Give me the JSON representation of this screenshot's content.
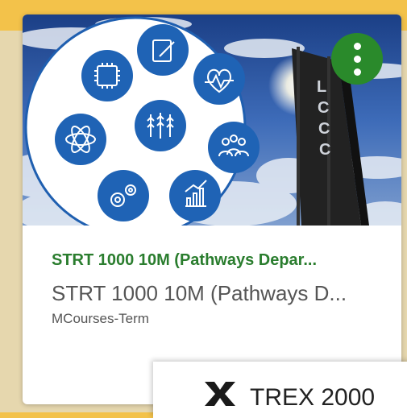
{
  "course_card": {
    "title": "STRT 1000 10M (Pathways Depar...",
    "subtitle": "STRT 1000 10M (Pathways D...",
    "term": "MCourses-Term",
    "banner_tower_text": "LCCC",
    "accent_color": "#2a8a2b",
    "icons": [
      "chip-icon",
      "edit-icon",
      "heart-monitor-icon",
      "atom-icon",
      "wheat-icon",
      "people-icon",
      "gears-icon",
      "chart-growth-icon"
    ]
  },
  "popup": {
    "name": "TREX 2000"
  }
}
